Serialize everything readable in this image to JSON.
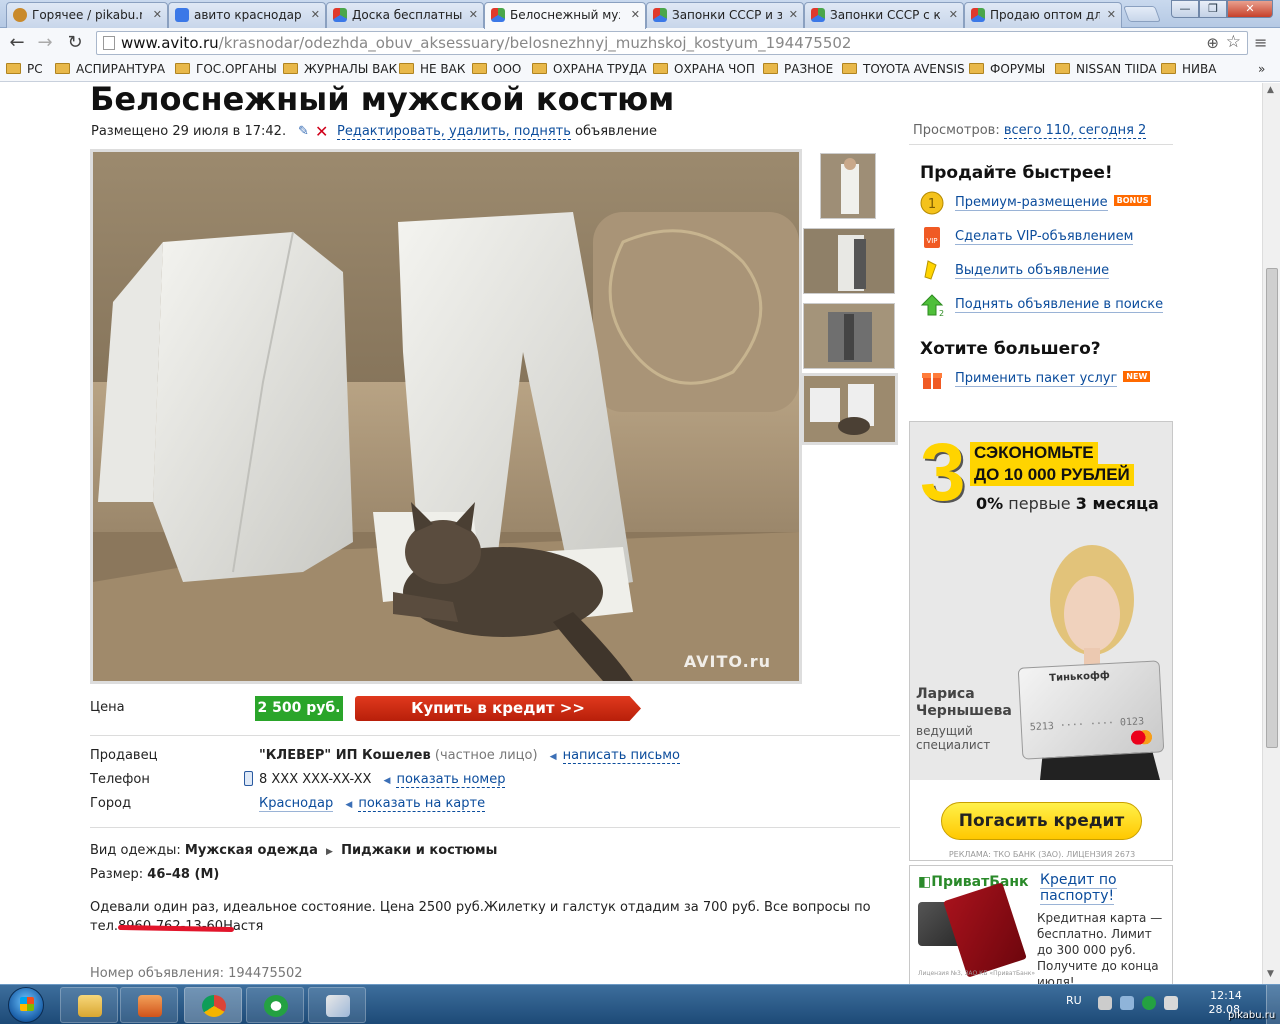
{
  "browser": {
    "tabs": [
      {
        "label": "Горячее / pikabu.ru",
        "favicon_color": "#c98a2b",
        "active": false
      },
      {
        "label": "авито краснодар -",
        "favicon_color": "#3b78e7",
        "active": false
      },
      {
        "label": "Доска бесплатных",
        "favicon_color": "#4aa64a",
        "active": false
      },
      {
        "label": "Белоснежный муж",
        "favicon_color": "#4aa64a",
        "active": true
      },
      {
        "label": "Запонки СССР и за",
        "favicon_color": "#4aa64a",
        "active": false
      },
      {
        "label": "Запонки СССР с ка",
        "favicon_color": "#4aa64a",
        "active": false
      },
      {
        "label": "Продаю оптом для",
        "favicon_color": "#4aa64a",
        "active": false
      }
    ],
    "window_buttons": {
      "minimize": "—",
      "maximize": "❐",
      "close": "✕"
    },
    "nav": {
      "back": "←",
      "forward": "→",
      "reload": "↻"
    },
    "url_host": "www.avito.ru",
    "url_path": "/krasnodar/odezhda_obuv_aksessuary/belosnezhnyj_muzhskoj_kostyum_194475502",
    "bookmarks": [
      "PC",
      "АСПИРАНТУРА",
      "ГОС.ОРГАНЫ",
      "ЖУРНАЛЫ ВАК",
      "НЕ ВАК",
      "ООО",
      "ОХРАНА ТРУДА",
      "ОХРАНА ЧОП",
      "РАЗНОЕ",
      "TOYOTA AVENSIS",
      "ФОРУМЫ",
      "NISSAN TIIDA",
      "НИВА"
    ],
    "bookmarks_more": "»"
  },
  "listing": {
    "title": "Белоснежный мужской костюм",
    "posted": "Размещено 29 июля в 17:42.",
    "edit_link": "Редактировать, удалить, поднять",
    "edit_suffix": "объявление",
    "watermark": "AVITO.ru",
    "price_label": "Цена",
    "price": "2 500 руб.",
    "credit_button": "Купить в кредит >>",
    "seller_label": "Продавец",
    "seller_name": "\"КЛЕВЕР\" ИП Кошелев",
    "seller_type": "(частное лицо)",
    "write_letter": "написать письмо",
    "phone_label": "Телефон",
    "phone": "8 XXX XXX-XX-XX",
    "show_number": "показать номер",
    "city_label": "Город",
    "city": "Краснодар",
    "show_map": "показать на карте",
    "clothing_label": "Вид одежды:",
    "clothing_cat": "Мужская одежда",
    "clothing_sub": "Пиджаки и костюмы",
    "size_label": "Размер:",
    "size": "46–48 (M)",
    "description_1": "Одевали один раз, идеальное состояние. Цена 2500 руб.Жилетку и галстук отдадим за 700 руб. Все вопросы по",
    "description_2": "тел.8960-762-13-60",
    "description_3": "Настя",
    "listing_no": "Номер объявления: 194475502"
  },
  "sidebar": {
    "views_label": "Просмотров:",
    "views_link": "всего 110, сегодня 2",
    "sell_title": "Продайте быстрее!",
    "services": [
      {
        "label": "Премиум-размещение",
        "badge": "BONUS"
      },
      {
        "label": "Сделать VIP-объявлением",
        "badge": ""
      },
      {
        "label": "Выделить объявление",
        "badge": ""
      },
      {
        "label": "Поднять объявление в поиске",
        "badge": ""
      }
    ],
    "more_title": "Хотите большего?",
    "package": {
      "label": "Применить пакет услуг",
      "badge": "NEW"
    },
    "vip_icon_text": "VIP",
    "up_icon_text": "2"
  },
  "ad_tinkoff": {
    "big_number": "3",
    "line1": "СЭКОНОМЬТЕ",
    "line2": "ДО 10 000 РУБЛЕЙ",
    "rate_value": "0%",
    "rate_mid": "первые",
    "rate_bold": "3 месяца",
    "name_line1": "Лариса",
    "name_line2": "Чернышева",
    "role_line1": "ведущий",
    "role_line2": "специалист",
    "card_brand": "Тинькофф",
    "card_number": "5213 ···· ···· 0123",
    "button": "Погасить кредит",
    "legal": "РЕКЛАМА: ТКО БАНК (ЗАО). ЛИЦЕНЗИЯ 2673"
  },
  "ad_privat": {
    "logo": "ПриватБанк",
    "link": "Кредит по паспорту!",
    "text": "Кредитная карта — бесплатно. Лимит до 300 000 руб. Получите до конца июля!",
    "legal": "Лицензия №3, ЗАО КБ «ПриватБанк»"
  },
  "taskbar": {
    "lang": "RU",
    "time": "12:14",
    "date": "28.08.",
    "source_mark": "pikabu.ru"
  }
}
